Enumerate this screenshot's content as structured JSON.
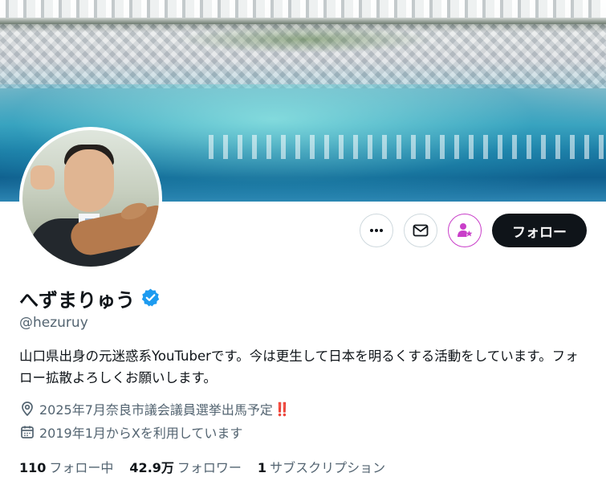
{
  "profile": {
    "display_name": "へずまりゅう",
    "handle": "@hezuruy",
    "verified_badge_icon": "verified-check-icon",
    "verified_color": "#1d9bf0",
    "bio": "山口県出身の元迷惑系YouTuberです。今は更生して日本を明るくする活動をしています。フォロー拡散よろしくお願いします。",
    "location": "2025年7月奈良市議会議員選挙出馬予定",
    "location_marks": "‼️",
    "joined": "2019年1月からXを利用しています"
  },
  "actions": {
    "more_icon": "more-dots-icon",
    "message_icon": "envelope-icon",
    "subscribe_icon": "subscribe-person-star-icon",
    "subscribe_color": "#c93fc9",
    "follow_label": "フォロー"
  },
  "stats": {
    "following_count": "110",
    "following_label": "フォロー中",
    "followers_count": "42.9万",
    "followers_label": "フォロワー",
    "subscriptions_count": "1",
    "subscriptions_label": "サブスクリプション"
  }
}
